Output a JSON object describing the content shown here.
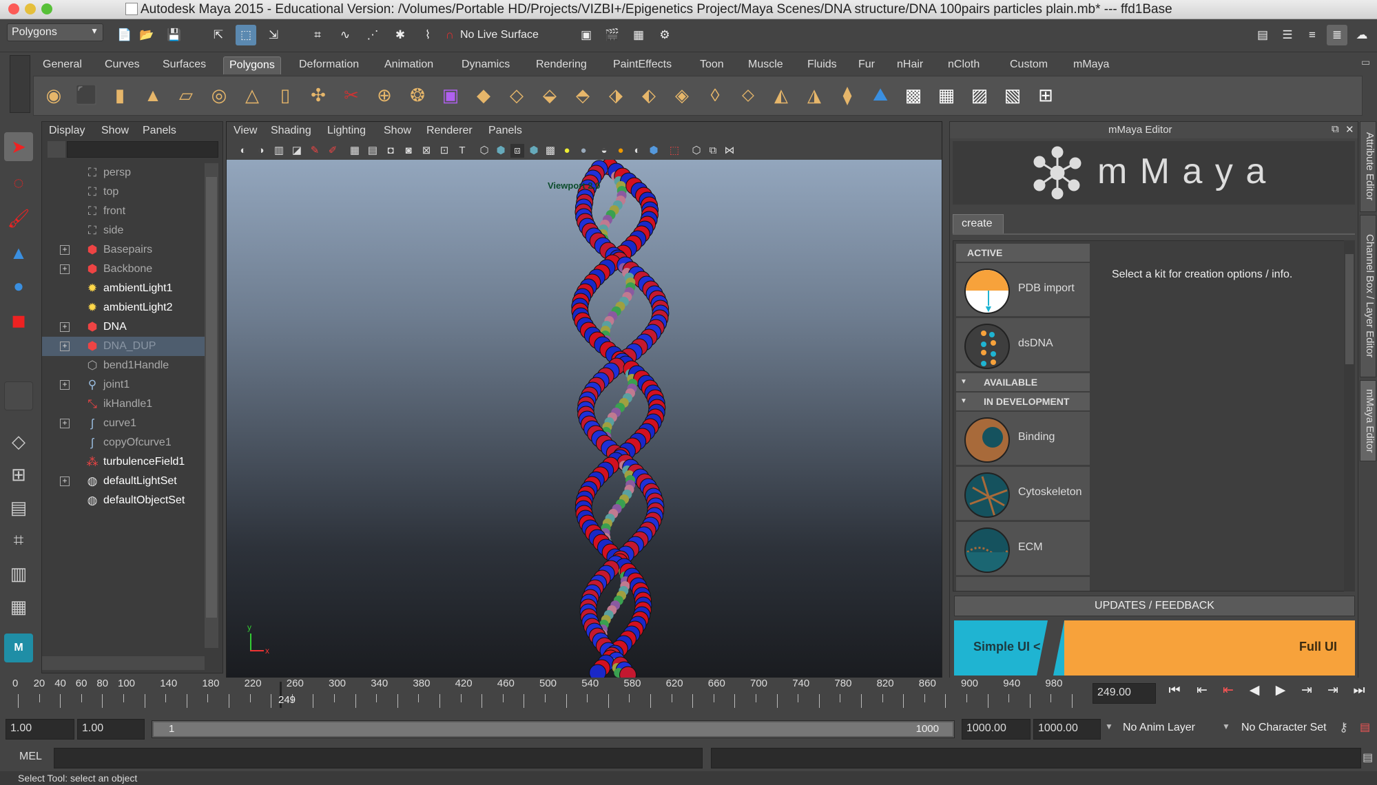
{
  "titlebar": {
    "title": "Autodesk Maya 2015 - Educational Version: /Volumes/Portable HD/Projects/VIZBI+/Epigenetics Project/Maya Scenes/DNA structure/DNA 100pairs particles plain.mb*   ---   ffd1Base"
  },
  "status_line": {
    "menu_set": "Polygons",
    "live_surface": "No Live Surface"
  },
  "shelf": {
    "tabs": [
      "General",
      "Curves",
      "Surfaces",
      "Polygons",
      "Deformation",
      "Animation",
      "Dynamics",
      "Rendering",
      "PaintEffects",
      "Toon",
      "Muscle",
      "Fluids",
      "Fur",
      "nHair",
      "nCloth",
      "Custom",
      "mMaya"
    ],
    "active_tab": "Polygons"
  },
  "outliner": {
    "menu": [
      "Display",
      "Show",
      "Panels"
    ],
    "items": [
      {
        "label": "persp",
        "icon": "camera-icon",
        "expandable": false,
        "style": "dim"
      },
      {
        "label": "top",
        "icon": "camera-icon",
        "expandable": false,
        "style": "dim"
      },
      {
        "label": "front",
        "icon": "camera-icon",
        "expandable": false,
        "style": "dim"
      },
      {
        "label": "side",
        "icon": "camera-icon",
        "expandable": false,
        "style": "dim"
      },
      {
        "label": "Basepairs",
        "icon": "transform-icon",
        "expandable": true,
        "style": "dim"
      },
      {
        "label": "Backbone",
        "icon": "transform-icon",
        "expandable": true,
        "style": "dim"
      },
      {
        "label": "ambientLight1",
        "icon": "light-icon",
        "expandable": false,
        "style": "bright"
      },
      {
        "label": "ambientLight2",
        "icon": "light-icon",
        "expandable": false,
        "style": "bright"
      },
      {
        "label": "DNA",
        "icon": "transform-icon",
        "expandable": true,
        "style": "bright"
      },
      {
        "label": "DNA_DUP",
        "icon": "transform-icon",
        "expandable": true,
        "style": "selected"
      },
      {
        "label": "bend1Handle",
        "icon": "handle-icon",
        "expandable": false,
        "style": "dim"
      },
      {
        "label": "joint1",
        "icon": "joint-icon",
        "expandable": true,
        "style": "dim"
      },
      {
        "label": "ikHandle1",
        "icon": "ikhandle-icon",
        "expandable": false,
        "style": "dim"
      },
      {
        "label": "curve1",
        "icon": "curve-icon",
        "expandable": true,
        "style": "dim"
      },
      {
        "label": "copyOfcurve1",
        "icon": "curve-icon",
        "expandable": false,
        "style": "dim"
      },
      {
        "label": "turbulenceField1",
        "icon": "field-icon",
        "expandable": false,
        "style": "bright"
      },
      {
        "label": "defaultLightSet",
        "icon": "set-icon",
        "expandable": true,
        "style": "bright"
      },
      {
        "label": "defaultObjectSet",
        "icon": "set-icon",
        "expandable": false,
        "style": "bright"
      }
    ]
  },
  "viewport": {
    "menu": [
      "View",
      "Shading",
      "Lighting",
      "Show",
      "Renderer",
      "Panels"
    ],
    "hud_text": "Viewport 2.0",
    "axis": {
      "y": "y",
      "x": "x"
    }
  },
  "mmaya": {
    "panel_title": "mMaya Editor",
    "logo_text": "m M a y a",
    "tab": "create",
    "sections": {
      "active": "ACTIVE",
      "available": "AVAILABLE",
      "in_development": "IN DEVELOPMENT"
    },
    "active_kits": [
      "PDB import",
      "dsDNA"
    ],
    "dev_kits": [
      "Binding",
      "Cytoskeleton",
      "ECM"
    ],
    "info": "Select a kit for creation options / info.",
    "updates": "UPDATES  /  FEEDBACK",
    "simple_ui": "Simple UI  <",
    "full_ui": "Full UI"
  },
  "side_tabs": [
    "Attribute Editor",
    "Channel Box / Layer Editor",
    "mMaya Editor"
  ],
  "timeline": {
    "ticks": [
      "0",
      "20",
      "40",
      "60",
      "80",
      "100",
      "140",
      "180",
      "220",
      "260",
      "300",
      "340",
      "380",
      "420",
      "460",
      "500",
      "540",
      "580",
      "620",
      "660",
      "700",
      "740",
      "780",
      "820",
      "860",
      "900",
      "940",
      "980"
    ],
    "current_marker": "249",
    "current_frame": "249.00"
  },
  "range": {
    "start": "1.00",
    "playback_start": "1.00",
    "slider_start": "1",
    "slider_end": "1000",
    "playback_end": "1000.00",
    "end": "1000.00",
    "anim_layer": "No Anim Layer",
    "character_set": "No Character Set"
  },
  "command": {
    "label": "MEL"
  },
  "help_line": "Select Tool: select an object",
  "colors": {
    "accent_teal": "#1fb4d2",
    "accent_orange": "#f7a23b",
    "selected_row": "#4e5d6e"
  }
}
